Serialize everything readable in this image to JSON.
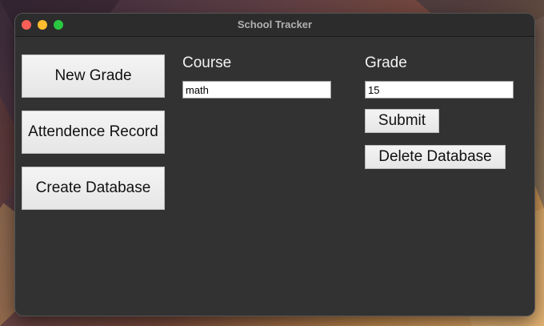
{
  "window": {
    "title": "School Tracker"
  },
  "sidebar": {
    "buttons": [
      {
        "label": "New Grade"
      },
      {
        "label": "Attendence Record"
      },
      {
        "label": "Create Database"
      }
    ]
  },
  "form": {
    "course": {
      "label": "Course",
      "value": "math"
    },
    "grade": {
      "label": "Grade",
      "value": "15"
    },
    "submit_label": "Submit",
    "delete_label": "Delete Database"
  },
  "colors": {
    "window_bg": "#323232",
    "traffic_close": "#ff5f57",
    "traffic_minimize": "#febc2e",
    "traffic_zoom": "#28c840"
  }
}
